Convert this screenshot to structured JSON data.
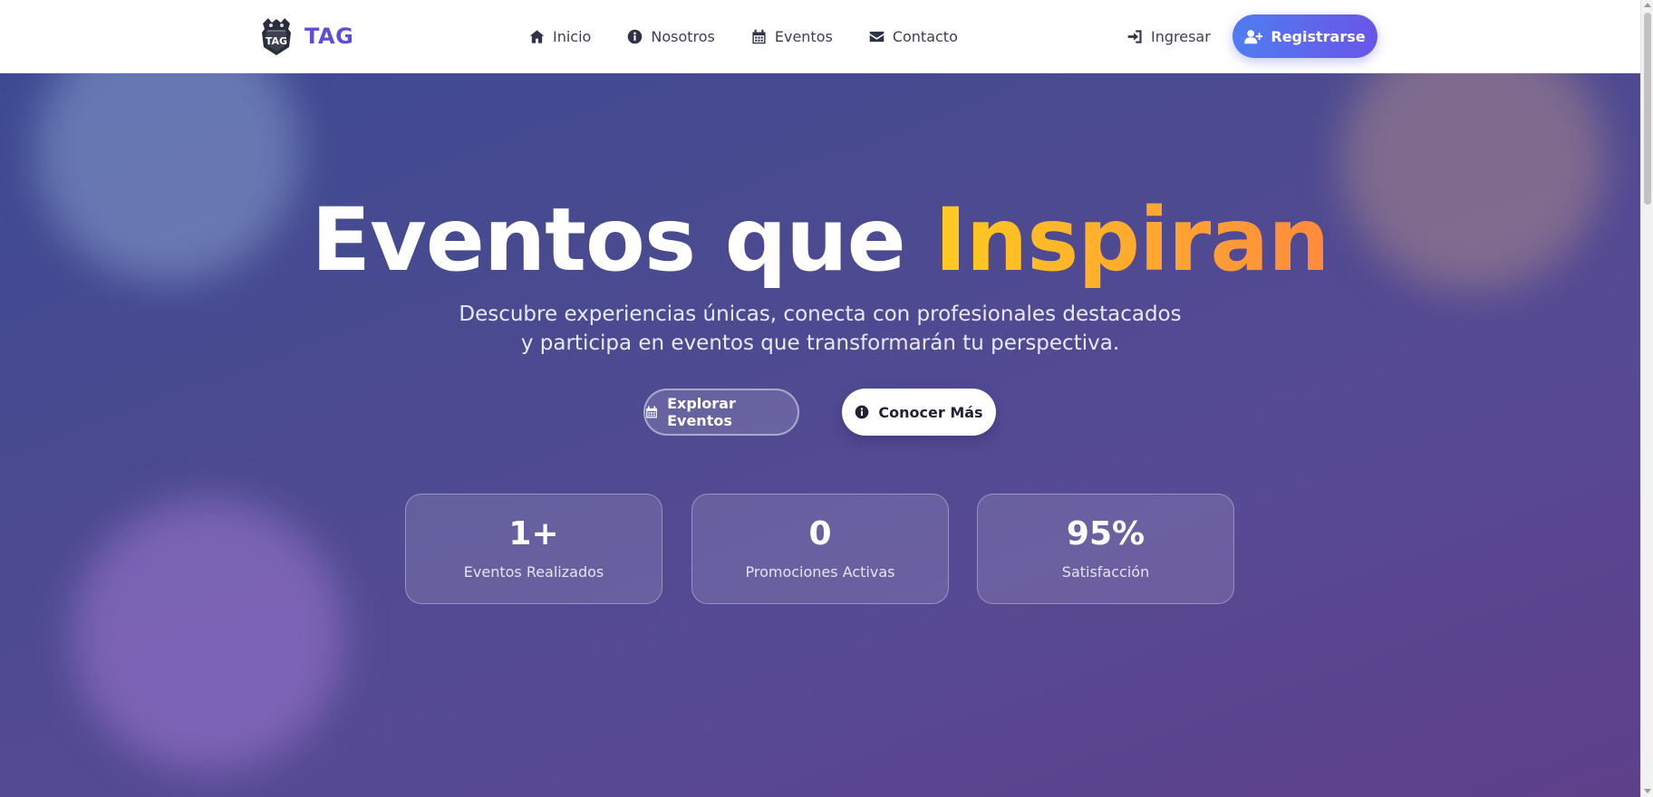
{
  "brand": {
    "name": "TAG",
    "logo_text": "TAG",
    "logo_icon": "tag-crest-logo"
  },
  "nav": {
    "links": [
      {
        "label": "Inicio",
        "icon": "home-icon"
      },
      {
        "label": "Nosotros",
        "icon": "info-circle-icon"
      },
      {
        "label": "Eventos",
        "icon": "calendar-icon"
      },
      {
        "label": "Contacto",
        "icon": "envelope-icon"
      }
    ],
    "login_label": "Ingresar",
    "login_icon": "sign-in-icon",
    "register_label": "Registrarse",
    "register_icon": "user-plus-icon"
  },
  "hero": {
    "title_main": "Eventos que",
    "title_accent": "Inspiran",
    "subtitle": "Descubre experiencias únicas, conecta con profesionales destacados y participa en eventos que transformarán tu perspectiva.",
    "explore_label": "Explorar Eventos",
    "more_label": "Conocer Más"
  },
  "stats": [
    {
      "value": "1+",
      "label": "Eventos Realizados"
    },
    {
      "value": "0",
      "label": "Promociones Activas"
    },
    {
      "value": "95%",
      "label": "Satisfacción"
    }
  ],
  "colors": {
    "brand": "#5a4fd6",
    "register_gradient_start": "#4f7df0",
    "register_gradient_end": "#6a55e8",
    "accent_gradient_start": "#ffcb1f",
    "accent_gradient_end": "#ff8a3d"
  }
}
